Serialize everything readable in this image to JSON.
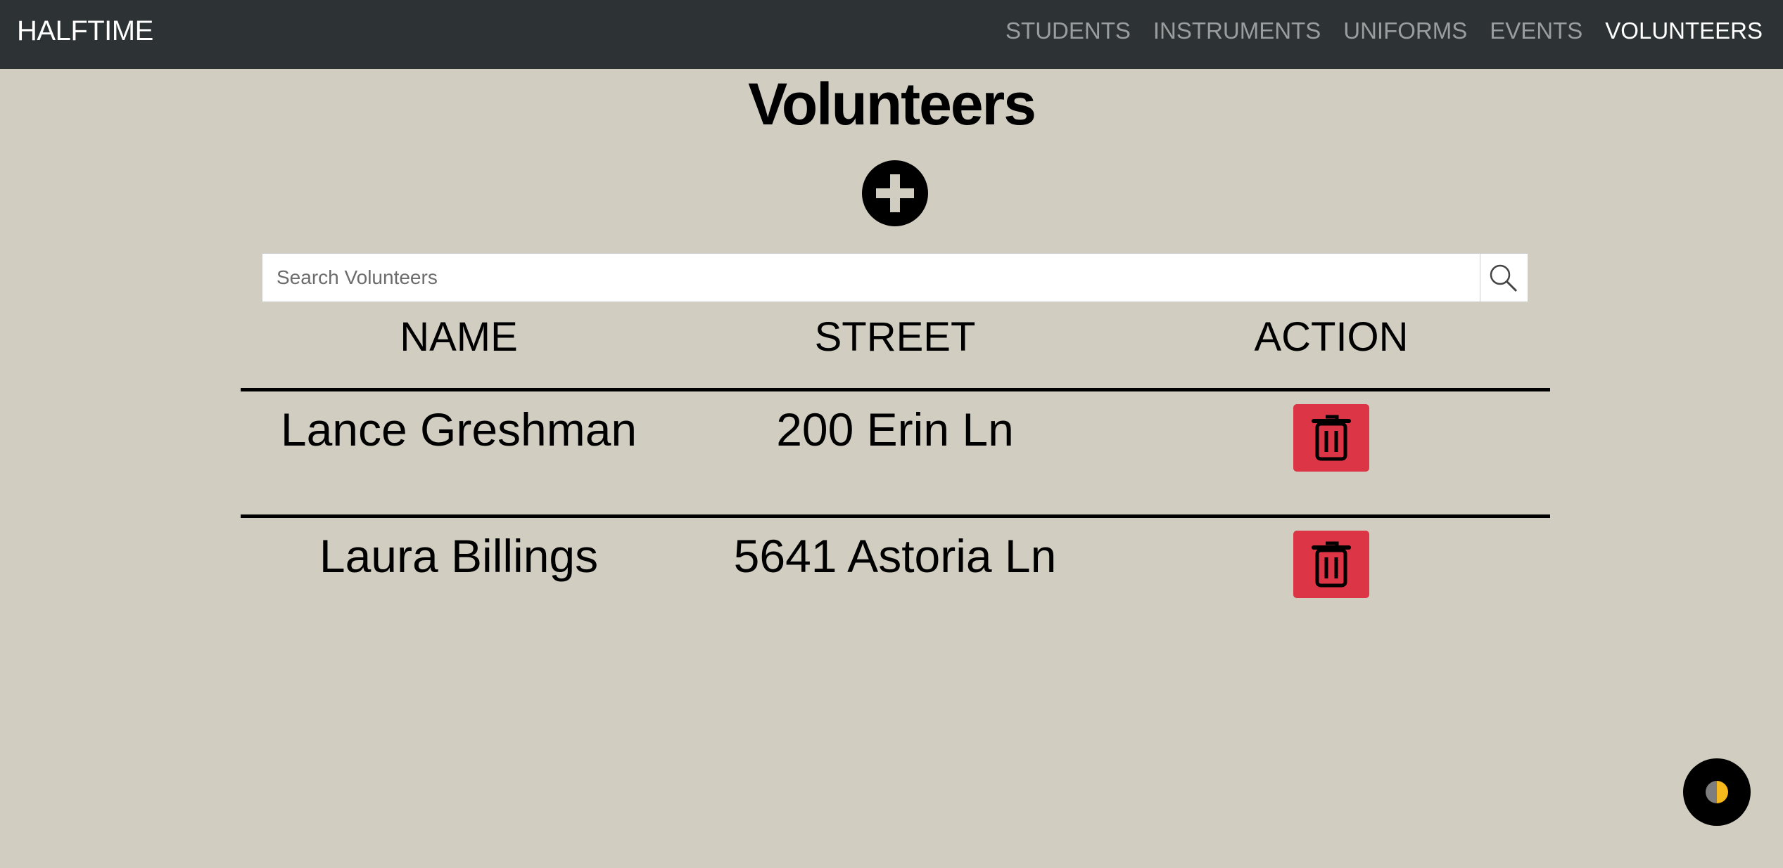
{
  "navbar": {
    "brand": "HALFTIME",
    "links": [
      {
        "label": "STUDENTS",
        "active": false
      },
      {
        "label": "INSTRUMENTS",
        "active": false
      },
      {
        "label": "UNIFORMS",
        "active": false
      },
      {
        "label": "EVENTS",
        "active": false
      },
      {
        "label": "VOLUNTEERS",
        "active": true
      }
    ]
  },
  "page": {
    "title": "Volunteers",
    "add_icon": "plus-circle-icon"
  },
  "search": {
    "placeholder": "Search Volunteers",
    "value": "",
    "icon": "search-icon"
  },
  "table": {
    "columns": [
      "NAME",
      "STREET",
      "ACTION"
    ],
    "rows": [
      {
        "name": "Lance Greshman",
        "street": "200 Erin Ln",
        "action_icon": "trash-icon"
      },
      {
        "name": "Laura Billings",
        "street": "5641 Astoria Ln",
        "action_icon": "trash-icon"
      }
    ]
  },
  "theme_toggle": {
    "icon": "half-moon-icon"
  },
  "colors": {
    "navbar_bg": "#2d3335",
    "page_bg": "#d1cdc1",
    "delete_button": "#dc3545",
    "theme_accent": "#f7b81c"
  }
}
